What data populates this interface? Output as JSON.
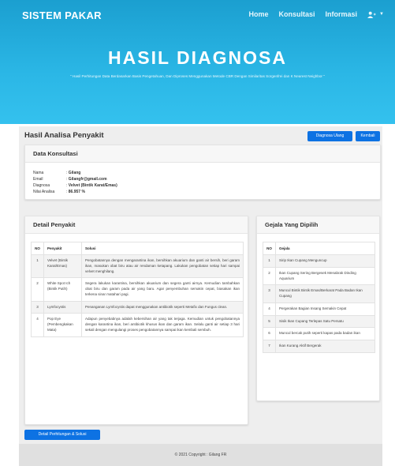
{
  "navbar": {
    "brand": "SISTEM PAKAR",
    "links": [
      "Home",
      "Konsultasi",
      "Informasi"
    ]
  },
  "hero": {
    "title": "HASIL DIAGNOSA",
    "subtitle": "\" Hasil Perhitungan Data Berdasarkan Basis Pengetahuan, Dan Diproses Menggunakan Metode CBR Dengan Similaritas Sorgenfrei dan K Nearest Neighbor \""
  },
  "page": {
    "title": "Hasil Analisa Penyakit",
    "btn_diagnosa": "Diagnosa Ulang",
    "btn_kembali": "Kembali",
    "btn_detail": "Detail Perhitungan & Solusi"
  },
  "konsultasi": {
    "header": "Data Konsultasi",
    "rows": [
      {
        "label": "Nama",
        "value": "Gilang"
      },
      {
        "label": "Email",
        "value": "Gilangfr@gmail.com"
      },
      {
        "label": "Diagnosa",
        "value": "Velvet (Bintik Karat/Emas)"
      },
      {
        "label": "Nilai Analisa",
        "value": "86.957 %"
      }
    ]
  },
  "penyakit": {
    "header": "Detail Penyakit",
    "columns": [
      "NO",
      "Penyakit",
      "Solusi"
    ],
    "rows": [
      {
        "no": "1",
        "penyakit": "Velvet (Bintik Karat/Emas)",
        "solusi": "Pengobatannya dengan mengarantina ikan, bersihkan akuarium dan ganti air bersih, beri garam ikan, masukan obat biru atau air rendaman ketapang. Lakukan pengobatan setiap hari sampai velvet menghilang."
      },
      {
        "no": "2",
        "penyakit": "White Spot Ich (Bintik Putih)",
        "solusi": "Segera lakukan karantina, bersihkan akuarium dan segera ganti airnya. Kemudian tambahkan obat biru dan garam pada air yang baru. Agar penyembuhan semakin cepat, biasakan ikan terkena sinar matahari pagi."
      },
      {
        "no": "3",
        "penyakit": "Lymfocystis",
        "solusi": "Penanganan Lymfocystis dapat menggunakan antibiotik seperti Metafix dan Fungus clean."
      },
      {
        "no": "4",
        "penyakit": "Pop Eye (Pembengkakan Mata)",
        "solusi": "Adapun penyebabnya adalah kebersihan air yang tak terjaga. Kemudian untuk pengobatannya dengan karantina ikan, beri antibiotik khusus ikan dan garam ikan. Selalu ganti air setiap 3 hari sekali dengan mengulangi proses pengobatannya sampai ikan kembali sembuh."
      }
    ]
  },
  "gejala": {
    "header": "Gejala Yang Dipilih",
    "columns": [
      "NO",
      "Gejala"
    ],
    "rows": [
      {
        "no": "1",
        "gejala": "Sirip Ikan Cupang Menguncup"
      },
      {
        "no": "2",
        "gejala": "Ikan Cupang Sering Bergesek Menabrak Dinding Aquarium"
      },
      {
        "no": "3",
        "gejala": "Muncul Bintik Bintik Emas/Berkarat Pada Badan Ikan Cupang"
      },
      {
        "no": "4",
        "gejala": "Pergerakan Bagian Insang Semakin Cepat"
      },
      {
        "no": "5",
        "gejala": "Sisik Ikan Cupang Terlepas Satu Persatu"
      },
      {
        "no": "6",
        "gejala": "Muncul bercak putih seperti kapas pada badan ikan"
      },
      {
        "no": "7",
        "gejala": "Ikan Kurang Aktif Bergerak"
      }
    ]
  },
  "footer": {
    "text": "© 2021 Copyright : Gilang FR"
  },
  "colors": {
    "hero": "#2bb7e6",
    "primary": "#0d72e3",
    "footer": "#e0e0e0"
  }
}
